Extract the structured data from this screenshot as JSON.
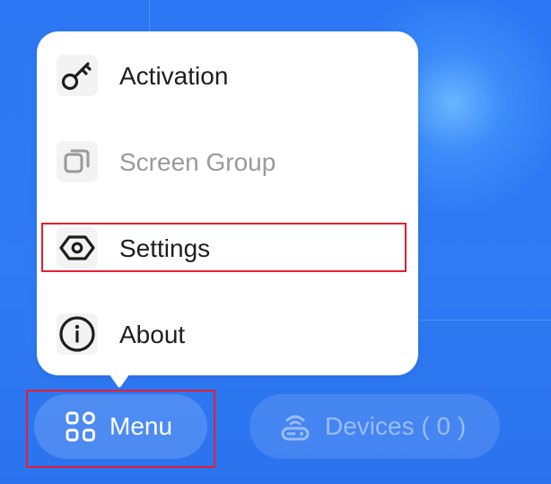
{
  "popup_menu": {
    "items": [
      {
        "label": "Activation",
        "icon": "key-icon",
        "enabled": true
      },
      {
        "label": "Screen Group",
        "icon": "layers-icon",
        "enabled": false
      },
      {
        "label": "Settings",
        "icon": "settings-icon",
        "enabled": true
      },
      {
        "label": "About",
        "icon": "info-icon",
        "enabled": true
      }
    ]
  },
  "bottom_bar": {
    "menu_label": "Menu",
    "menu_icon": "grid-icon",
    "devices_label": "Devices ( 0 )",
    "devices_icon": "device-icon"
  },
  "colors": {
    "background": "#2f7bf4",
    "popup_background": "#ffffff",
    "highlight": "#e61e2e",
    "text_primary": "#1e1e1e",
    "text_disabled": "#9a9a9a"
  }
}
